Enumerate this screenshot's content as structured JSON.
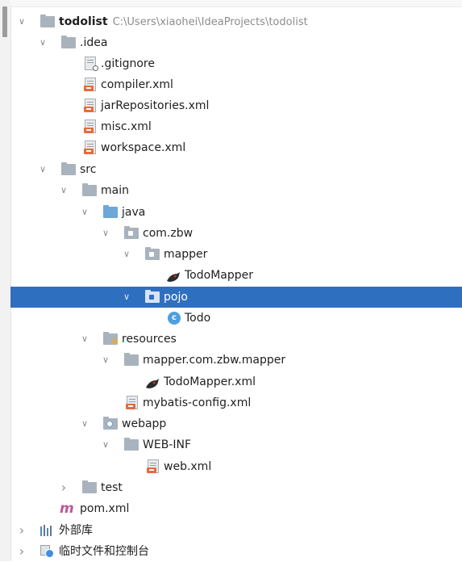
{
  "project": {
    "name": "todolist",
    "path": "C:\\Users\\xiaohei\\IdeaProjects\\todolist"
  },
  "tree": {
    "idea": ".idea",
    "gitignore": ".gitignore",
    "compiler": "compiler.xml",
    "jar_repositories": "jarRepositories.xml",
    "misc": "misc.xml",
    "workspace": "workspace.xml",
    "src": "src",
    "main": "main",
    "java": "java",
    "com_zbw": "com.zbw",
    "mapper": "mapper",
    "todo_mapper": "TodoMapper",
    "pojo": "pojo",
    "todo": "Todo",
    "resources": "resources",
    "mapper_pkg": "mapper.com.zbw.mapper",
    "todo_mapper_xml": "TodoMapper.xml",
    "mybatis_config": "mybatis-config.xml",
    "webapp": "webapp",
    "web_inf": "WEB-INF",
    "web_xml": "web.xml",
    "test": "test",
    "pom": "pom.xml",
    "external_libraries": "外部库",
    "scratches": "临时文件和控制台"
  },
  "glyphs": {
    "expanded": "∨",
    "collapsed": "›",
    "maven": "m",
    "class": "c"
  },
  "colors": {
    "selection": "#2f6fc0",
    "folder": "#a9b3bd",
    "source_folder": "#6ea6d9",
    "xml_badge": "#e66b3c",
    "class_icon": "#4d9fe0",
    "maven_icon": "#c0549a",
    "path_text": "#8c8c8c"
  },
  "icons": {
    "module": "module-folder-icon",
    "folder": "folder-icon",
    "source_root": "source-root-icon",
    "package": "package-icon",
    "resources_root": "resources-root-icon",
    "web_folder": "web-folder-icon",
    "xml_file": "xml-file-icon",
    "ignore_file": "ignore-file-icon",
    "mybatis": "mybatis-bird-icon",
    "java_class": "java-class-icon",
    "maven": "maven-icon",
    "libraries": "libraries-icon",
    "scratches": "scratches-icon"
  }
}
